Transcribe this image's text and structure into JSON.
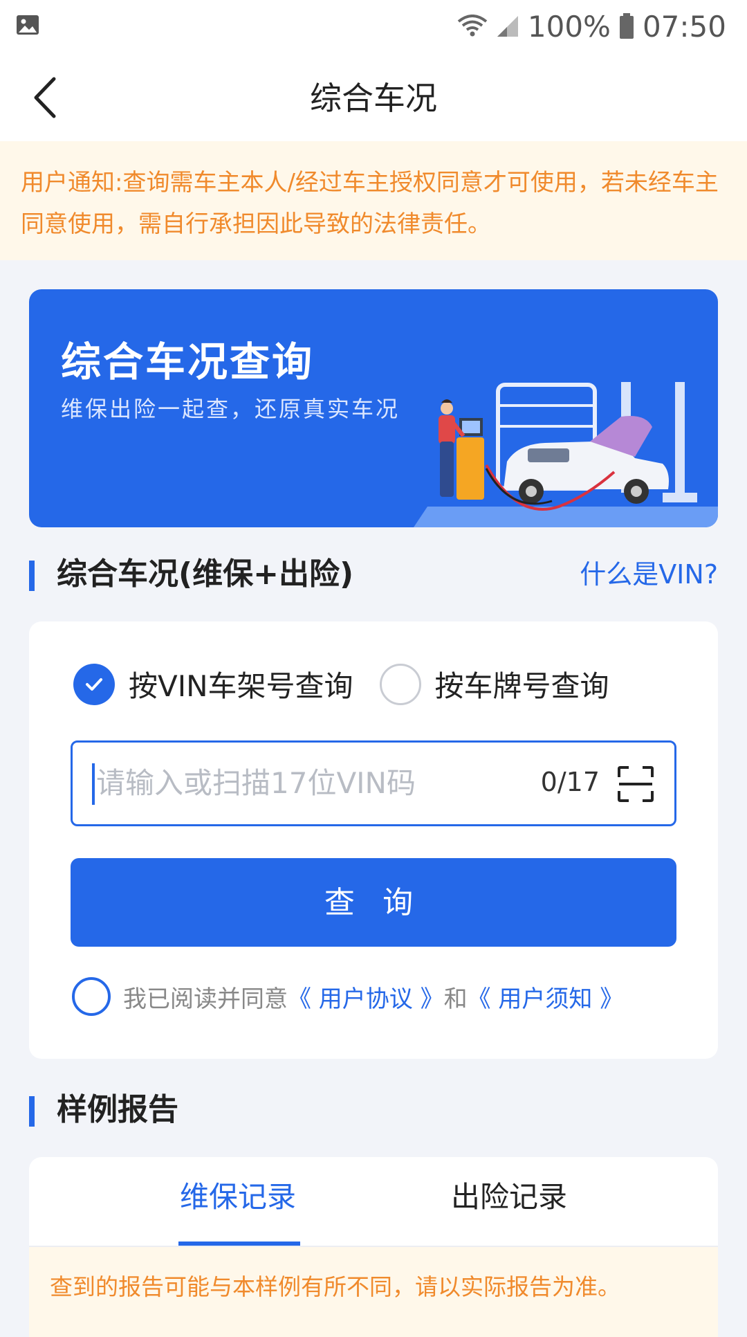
{
  "status_bar": {
    "battery": "100%",
    "time": "07:50",
    "icons": [
      "image-icon",
      "wifi-icon",
      "signal-icon",
      "battery-icon"
    ]
  },
  "header": {
    "title": "综合车况",
    "back_icon": "chevron-left-icon"
  },
  "notice": {
    "text": "用户通知:查询需车主本人/经过车主授权同意才可使用，若未经车主同意使用，需自行承担因此导致的法律责任。"
  },
  "banner": {
    "title": "综合车况查询",
    "subtitle": "维保出险一起查，还原真实车况"
  },
  "query_section": {
    "title": "综合车况(维保+出险)",
    "help_link": "什么是VIN?",
    "options": [
      {
        "label": "按VIN车架号查询",
        "checked": true
      },
      {
        "label": "按车牌号查询",
        "checked": false
      }
    ],
    "input": {
      "placeholder": "请输入或扫描17位VIN码",
      "value": "",
      "counter": "0/17",
      "scan_icon": "scan-icon"
    },
    "submit_label": "查 询",
    "agreement": {
      "prefix": "我已阅读并同意",
      "link1": "《 用户协议 》",
      "middle": "和",
      "link2": "《 用户须知 》",
      "checked": false
    }
  },
  "sample_section": {
    "title": "样例报告",
    "tabs": [
      {
        "label": "维保记录",
        "active": true
      },
      {
        "label": "出险记录",
        "active": false
      }
    ],
    "notice": "查到的报告可能与本样例有所不同，请以实际报告为准。"
  },
  "colors": {
    "accent": "#2568e8",
    "notice_text": "#f08a2c",
    "notice_bg": "#fff8ea",
    "page_bg": "#f2f4f9"
  }
}
